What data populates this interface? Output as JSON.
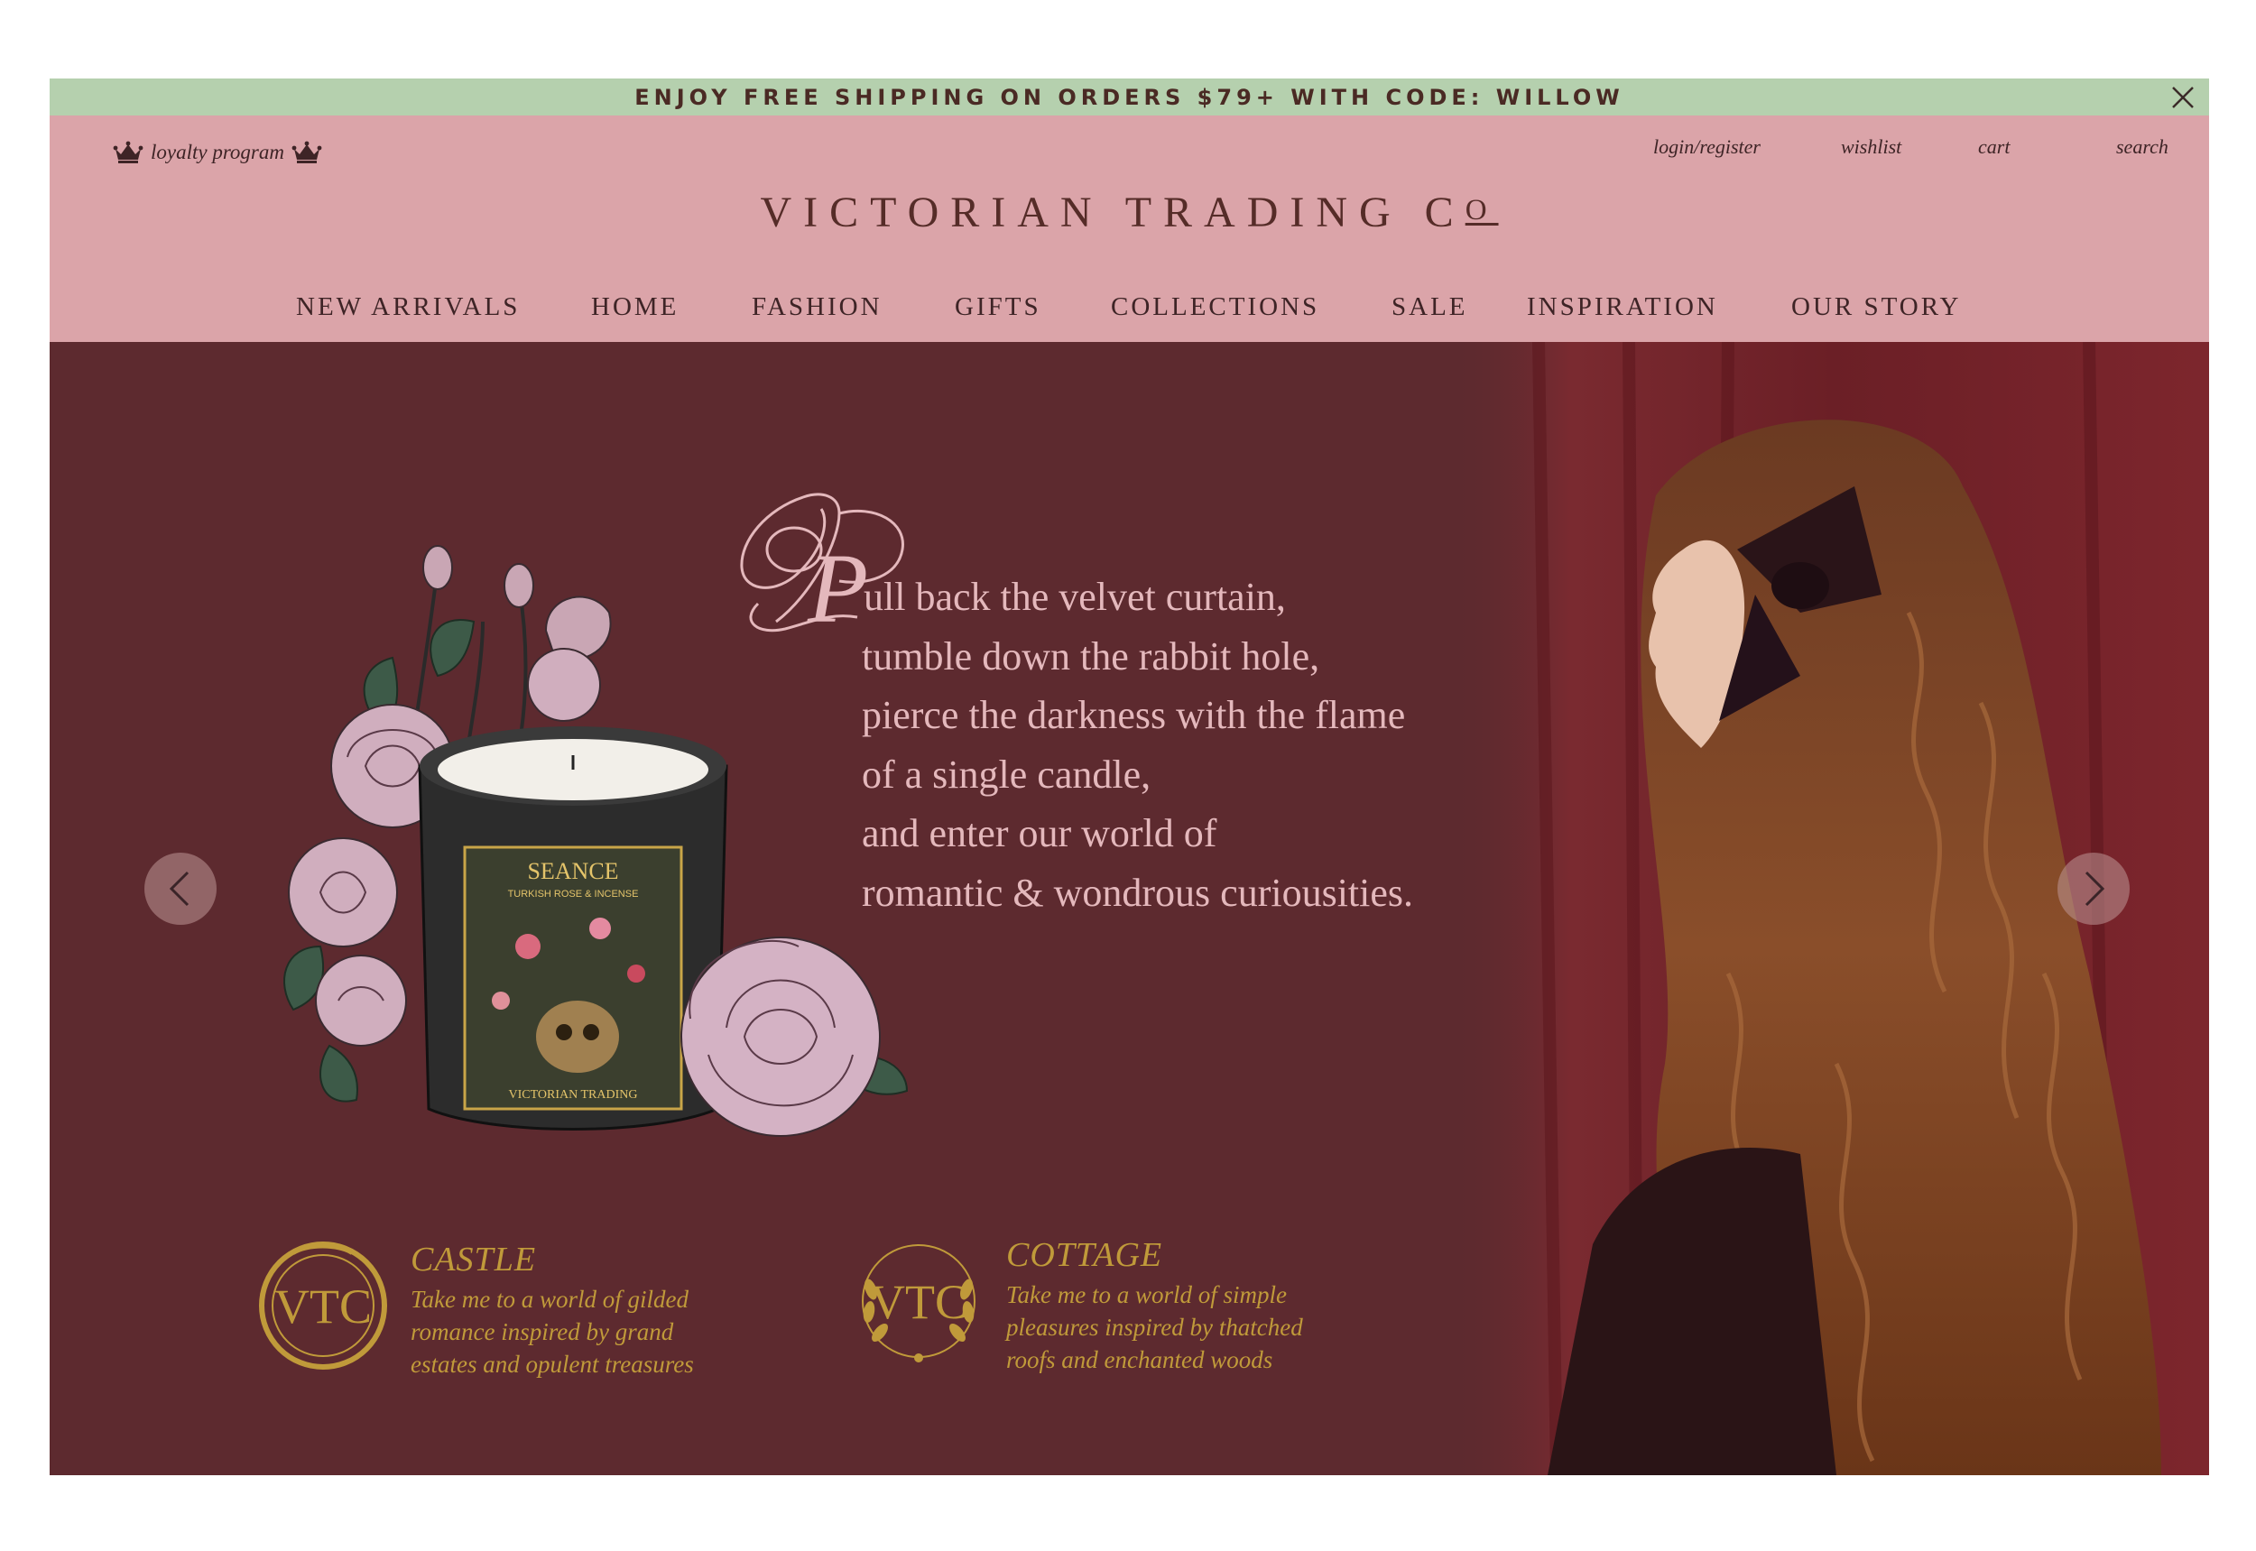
{
  "announcement": {
    "text": "ENJOY FREE SHIPPING ON ORDERS $79+ WITH CODE: WILLOW",
    "close_icon": "close-icon"
  },
  "header": {
    "loyalty_label": "loyalty program",
    "utility_links": [
      "login/register",
      "wishlist",
      "cart",
      "search"
    ],
    "brand_main": "VICTORIAN TRADING C",
    "brand_sub": "O"
  },
  "nav": {
    "items": [
      "NEW ARRIVALS",
      "HOME",
      "FASHION",
      "GIFTS",
      "COLLECTIONS",
      "SALE",
      "INSPIRATION",
      "OUR STORY"
    ]
  },
  "hero": {
    "drop_cap": "P",
    "poem": [
      "ull  back the velvet curtain,",
      "tumble down the rabbit hole,",
      "pierce the darkness with the flame",
      "of a single candle,",
      "and enter our world of",
      "romantic & wondrous curiousities."
    ],
    "product_label": "SEANCE",
    "product_sublabel": "TURKISH ROSE & INCENSE",
    "product_brand": "VICTORIAN TRADING",
    "prev_icon": "chevron-left-icon",
    "next_icon": "chevron-right-icon"
  },
  "collections": [
    {
      "title": "CASTLE",
      "lines": [
        "Take me to a world of gilded",
        "romance inspired by grand",
        "estates and opulent treasures"
      ],
      "emblem": "VTC"
    },
    {
      "title": "COTTAGE",
      "lines": [
        "Take me to a world of simple",
        "pleasures inspired by thatched",
        "roofs and enchanted woods"
      ],
      "emblem": "VTC"
    }
  ],
  "colors": {
    "announcement_bg": "#b5d0ae",
    "header_bg": "#dba4a9",
    "hero_bg": "#5d2a2f",
    "poem_text": "#e4b8bc",
    "gold": "#c09a3a"
  }
}
